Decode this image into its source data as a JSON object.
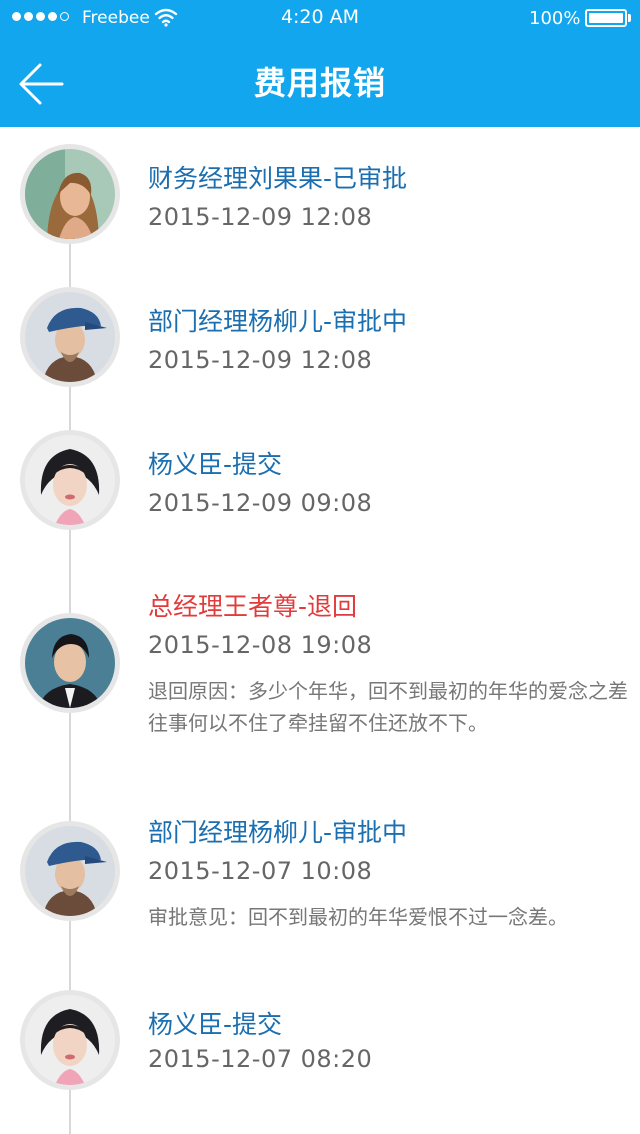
{
  "status_bar": {
    "carrier": "Freebee",
    "time": "4:20 AM",
    "battery": "100%"
  },
  "header": {
    "title": "费用报销"
  },
  "timeline": [
    {
      "name": "财务经理刘果果-已审批",
      "date": "2015-12-09   12:08",
      "note": ""
    },
    {
      "name": "部门经理杨柳儿-审批中",
      "date": "2015-12-09   12:08",
      "note": ""
    },
    {
      "name": "杨义臣-提交",
      "date": "2015-12-09   09:08",
      "note": ""
    },
    {
      "name": "总经理王者尊-退回",
      "date": "2015-12-08   19:08",
      "note": "退回原因：多少个年华，回不到最初的年华的爱念之差往事何以不住了牵挂留不住还放不下。"
    },
    {
      "name": "部门经理杨柳儿-审批中",
      "date": "2015-12-07 10:08",
      "note": "审批意见：回不到最初的年华爱恨不过一念差。"
    },
    {
      "name": "杨义臣-提交",
      "date": "2015-12-07   08:20",
      "note": ""
    }
  ],
  "colors": {
    "header_bg": "#11a6ee",
    "name_blue": "#1b6fb0",
    "name_red": "#e23b3b"
  }
}
